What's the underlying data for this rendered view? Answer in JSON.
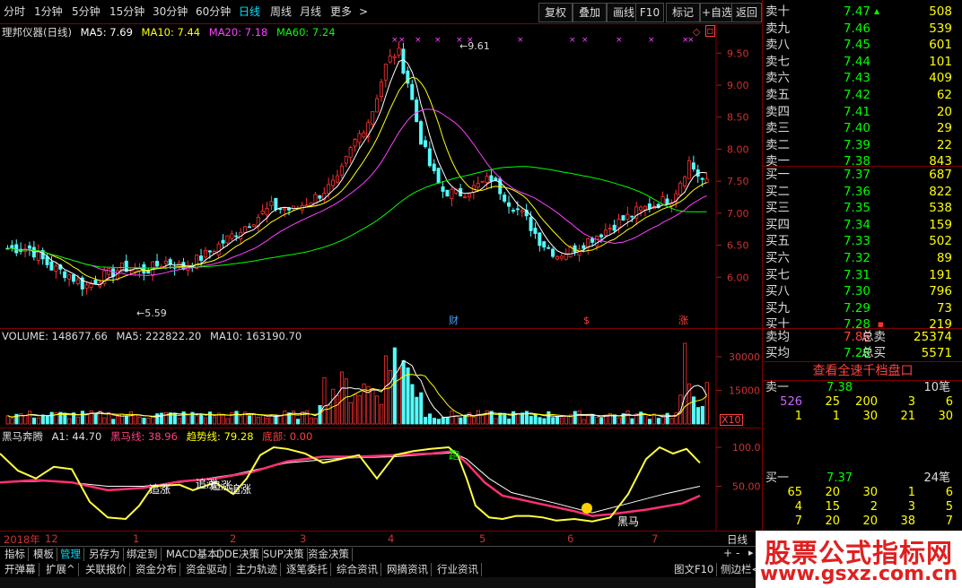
{
  "periods": [
    "分时",
    "1分钟",
    "5分钟",
    "15分钟",
    "30分钟",
    "60分钟",
    "日线",
    "周线",
    "月线",
    "更多"
  ],
  "active_period": "日线",
  "toolbar": [
    "复权",
    "叠加",
    "画线",
    "F10",
    "标记",
    "+自选",
    "返回"
  ],
  "main": {
    "stock": "理邦仪器(日线)",
    "ma5": "MA5: 7.69",
    "ma10": "MA10: 7.44",
    "ma20": "MA20: 7.18",
    "ma60": "MA60: 7.24",
    "high_label": "9.61",
    "low_label": "5.59",
    "markers": [
      "财",
      "$",
      "涨"
    ],
    "y_ticks": [
      "9.50",
      "9.00",
      "8.50",
      "8.00",
      "7.50",
      "7.00",
      "6.50",
      "6.00"
    ]
  },
  "volume": {
    "vol": "VOLUME: 148677.66",
    "ma5": "MA5: 222822.20",
    "ma10": "MA10: 163190.70",
    "y_ticks": [
      "30000",
      "15000"
    ],
    "unit": "X10"
  },
  "indicator": {
    "name": "黑马奔腾",
    "a1": "A1: 44.70",
    "hm": "黑马线: 38.96",
    "qs": "趋势线: 79.28",
    "db": "底部: 0.00",
    "y_ticks": [
      "100.0",
      "50.00"
    ],
    "labels": [
      "追涨",
      "追涨",
      "追涨",
      "追涨",
      "黑马",
      "跑"
    ]
  },
  "dates": [
    "2018年",
    "12",
    "1",
    "2",
    "3",
    "4",
    "5",
    "6",
    "7"
  ],
  "date_unit": "日线",
  "tabs1": [
    "指标",
    "模板",
    "管理",
    "另存为",
    "绑定到",
    "MACD基本",
    "DDE决策",
    "SUP决策",
    "资金决策"
  ],
  "tabs1_selected": "管理",
  "tabs2": [
    "开弹幕",
    "扩展^",
    "关联报价",
    "资金分布",
    "资金驱动",
    "主力轨迹",
    "逐笔委托",
    "综合资讯",
    "网摘资讯",
    "行业资讯"
  ],
  "tabs2_right": [
    "图文F10",
    "侧边栏<"
  ],
  "book": {
    "asks": [
      {
        "label": "卖十",
        "price": "7.47",
        "vol": "508"
      },
      {
        "label": "卖九",
        "price": "7.46",
        "vol": "539"
      },
      {
        "label": "卖八",
        "price": "7.45",
        "vol": "601"
      },
      {
        "label": "卖七",
        "price": "7.44",
        "vol": "101"
      },
      {
        "label": "卖六",
        "price": "7.43",
        "vol": "409"
      },
      {
        "label": "卖五",
        "price": "7.42",
        "vol": "62"
      },
      {
        "label": "卖四",
        "price": "7.41",
        "vol": "20"
      },
      {
        "label": "卖三",
        "price": "7.40",
        "vol": "29"
      },
      {
        "label": "卖二",
        "price": "7.39",
        "vol": "22"
      },
      {
        "label": "卖一",
        "price": "7.38",
        "vol": "843"
      }
    ],
    "bids": [
      {
        "label": "买一",
        "price": "7.37",
        "vol": "687"
      },
      {
        "label": "买二",
        "price": "7.36",
        "vol": "822"
      },
      {
        "label": "买三",
        "price": "7.35",
        "vol": "538"
      },
      {
        "label": "买四",
        "price": "7.34",
        "vol": "159"
      },
      {
        "label": "买五",
        "price": "7.33",
        "vol": "502"
      },
      {
        "label": "买六",
        "price": "7.32",
        "vol": "89"
      },
      {
        "label": "买七",
        "price": "7.31",
        "vol": "191"
      },
      {
        "label": "买八",
        "price": "7.30",
        "vol": "796"
      },
      {
        "label": "买九",
        "price": "7.29",
        "vol": "73"
      },
      {
        "label": "买十",
        "price": "7.28",
        "vol": "219"
      }
    ],
    "avg_sell_label": "卖均",
    "avg_sell": "7.86",
    "total_sell_label": "总卖",
    "total_sell": "25374",
    "avg_buy_label": "买均",
    "avg_buy": "7.28",
    "total_buy_label": "总买",
    "total_buy": "5571",
    "quick_link": "查看全速千档盘口",
    "sell1": {
      "label": "卖一",
      "price": "7.38",
      "count": "10笔",
      "q1": [
        "526",
        "25",
        "200",
        "3",
        "6"
      ],
      "q2": [
        "1",
        "1",
        "30",
        "21",
        "30"
      ]
    },
    "buy1": {
      "label": "买一",
      "price": "7.37",
      "count": "24笔",
      "q1": [
        "65",
        "20",
        "30",
        "1",
        "6"
      ],
      "q2": [
        "4",
        "15",
        "2",
        "3",
        "5"
      ],
      "q3": [
        "7",
        "20",
        "20",
        "38",
        "7"
      ]
    }
  },
  "watermark": {
    "line1": "股票公式指标网",
    "line2": "www.gsxz.com.cn"
  }
}
